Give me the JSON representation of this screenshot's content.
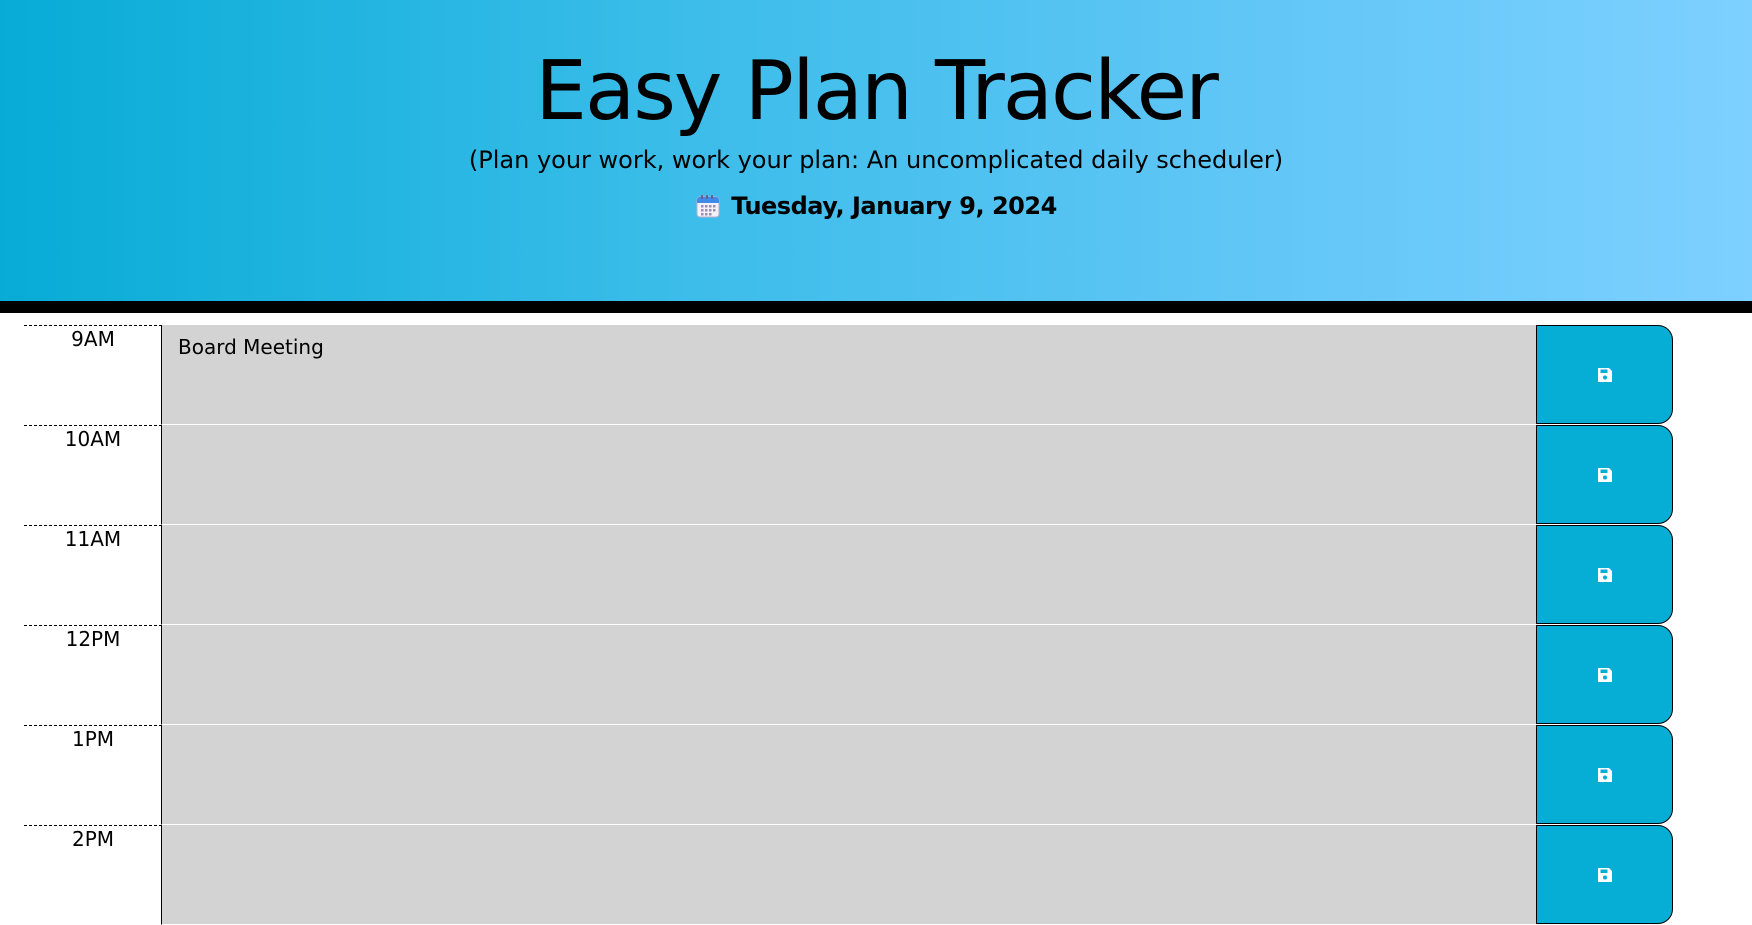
{
  "header": {
    "title": "Easy Plan Tracker",
    "subtitle": "(Plan your work, work your plan: An uncomplicated daily scheduler)",
    "date_icon": "calendar-icon",
    "current_day": "Tuesday, January 9, 2024"
  },
  "planner": {
    "rows": [
      {
        "hour": "9AM",
        "description": "Board Meeting",
        "save_icon": "save-icon"
      },
      {
        "hour": "10AM",
        "description": "",
        "save_icon": "save-icon"
      },
      {
        "hour": "11AM",
        "description": "",
        "save_icon": "save-icon"
      },
      {
        "hour": "12PM",
        "description": "",
        "save_icon": "save-icon"
      },
      {
        "hour": "1PM",
        "description": "",
        "save_icon": "save-icon"
      },
      {
        "hour": "2PM",
        "description": "",
        "save_icon": "save-icon"
      }
    ]
  },
  "colors": {
    "header_gradient_start": "#07acd6",
    "header_gradient_end": "#7dd0ff",
    "save_button": "#06aed5",
    "textarea_past": "#d3d3d3",
    "header_border": "#000000"
  }
}
